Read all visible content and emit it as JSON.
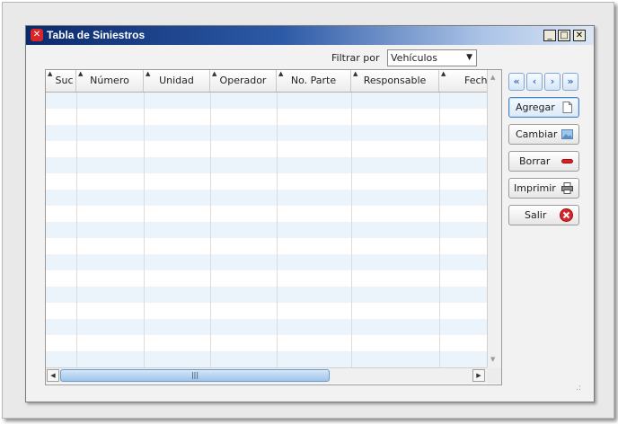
{
  "window": {
    "title": "Tabla de Siniestros",
    "controls": {
      "minimize": "_",
      "maximize": "□",
      "close": "✕"
    }
  },
  "filter": {
    "label": "Filtrar por",
    "selected": "Vehículos"
  },
  "table": {
    "columns": [
      "Suc",
      "Número",
      "Unidad",
      "Operador",
      "No. Parte",
      "Responsable",
      "Fech"
    ],
    "rows": []
  },
  "navigation": {
    "first": "«",
    "previous": "‹",
    "next": "›",
    "last": "»"
  },
  "actions": {
    "add": "Agregar",
    "edit": "Cambiar",
    "delete": "Borrar",
    "print": "Imprimir",
    "exit": "Salir"
  },
  "colors": {
    "title_gradient_start": "#0b2a6e",
    "row_alt": "#ebf3fb",
    "accent": "#4a86c7",
    "exit_icon": "#d8262b"
  }
}
